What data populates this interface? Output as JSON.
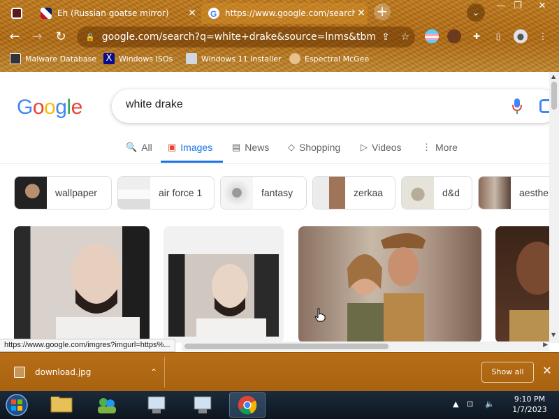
{
  "browser": {
    "tabs": [
      {
        "title": "",
        "active": false
      },
      {
        "title": "Eh (Russian goatse mirror)",
        "active": false
      },
      {
        "title": "https://www.google.com/search?q",
        "active": true
      }
    ],
    "new_tab_label": "+",
    "tab_close_glyph": "✕",
    "url": "google.com/search?q=white+drake&source=lnms&tbm=isc",
    "bookmarks": [
      {
        "label": "Malware Database"
      },
      {
        "label": "Windows ISOs"
      },
      {
        "label": "Windows 11 Installer"
      },
      {
        "label": "Espectral McGee"
      }
    ]
  },
  "google": {
    "logo_letters": [
      {
        "ch": "G",
        "color": "#4285f4"
      },
      {
        "ch": "o",
        "color": "#ea4335"
      },
      {
        "ch": "o",
        "color": "#fbbc05"
      },
      {
        "ch": "g",
        "color": "#4285f4"
      },
      {
        "ch": "l",
        "color": "#34a853"
      },
      {
        "ch": "e",
        "color": "#ea4335"
      }
    ],
    "query": "white drake",
    "nav_tabs": [
      {
        "label": "All",
        "icon": "search-icon",
        "glyph": "🔍"
      },
      {
        "label": "Images",
        "icon": "image-icon",
        "glyph": "▣"
      },
      {
        "label": "News",
        "icon": "news-icon",
        "glyph": "▤"
      },
      {
        "label": "Shopping",
        "icon": "tag-icon",
        "glyph": "◇"
      },
      {
        "label": "Videos",
        "icon": "play-icon",
        "glyph": "▷"
      },
      {
        "label": "More",
        "icon": "more-vert-icon",
        "glyph": "⋮"
      }
    ],
    "chips": [
      {
        "label": "wallpaper"
      },
      {
        "label": "air force 1"
      },
      {
        "label": "fantasy"
      },
      {
        "label": "zerkaa"
      },
      {
        "label": "d&d"
      },
      {
        "label": "aesthe"
      }
    ]
  },
  "status_url": "https://www.google.com/imgres?imgurl=https%...",
  "downloads": {
    "file": "download.jpg",
    "show_all": "Show all"
  },
  "taskbar": {
    "time": "9:10 PM",
    "date": "1/7/2023"
  },
  "colors": {
    "accent": "#1a73e8",
    "frame": "#b06a14"
  }
}
